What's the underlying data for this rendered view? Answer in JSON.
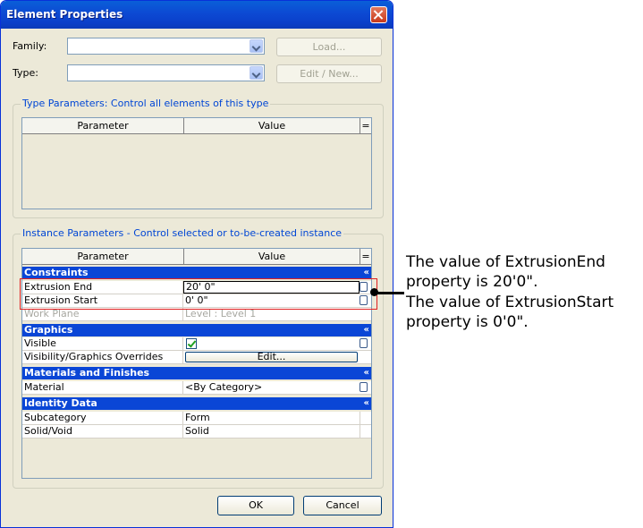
{
  "window": {
    "title": "Element Properties"
  },
  "top": {
    "family_label": "Family:",
    "type_label": "Type:",
    "family_value": "",
    "type_value": "",
    "load_button": "Load...",
    "edit_new_button": "Edit / New..."
  },
  "type_params": {
    "title": "Type Parameters: Control all elements of this type",
    "col_parameter": "Parameter",
    "col_value": "Value",
    "col_eq": "="
  },
  "instance_params": {
    "title": "Instance Parameters - Control selected or to-be-created instance",
    "col_parameter": "Parameter",
    "col_value": "Value",
    "col_eq": "=",
    "collapse_glyph": "«",
    "categories": {
      "constraints": "Constraints",
      "graphics": "Graphics",
      "materials": "Materials and Finishes",
      "identity": "Identity Data"
    },
    "rows": {
      "extrusion_end": {
        "param": "Extrusion End",
        "value": "20'  0\""
      },
      "extrusion_start": {
        "param": "Extrusion Start",
        "value": "0'  0\""
      },
      "work_plane": {
        "param": "Work Plane",
        "value": "Level : Level 1"
      },
      "visible": {
        "param": "Visible",
        "checked": true
      },
      "vis_overrides": {
        "param": "Visibility/Graphics Overrides",
        "value": "Edit..."
      },
      "material": {
        "param": "Material",
        "value": "<By Category>"
      },
      "subcategory": {
        "param": "Subcategory",
        "value": "Form"
      },
      "solid_void": {
        "param": "Solid/Void",
        "value": "Solid"
      }
    }
  },
  "buttons": {
    "ok": "OK",
    "cancel": "Cancel"
  },
  "annotation": {
    "line1": "The value of ExtrusionEnd",
    "line2": "property is 20'0\".",
    "line3": "The value of ExtrusionStart",
    "line4": "property is 0'0\"."
  },
  "colors": {
    "title_bar": "#0a46d6",
    "category_bar": "#0a46d6",
    "highlight_box": "#e02020",
    "group_title": "#0046d5"
  }
}
